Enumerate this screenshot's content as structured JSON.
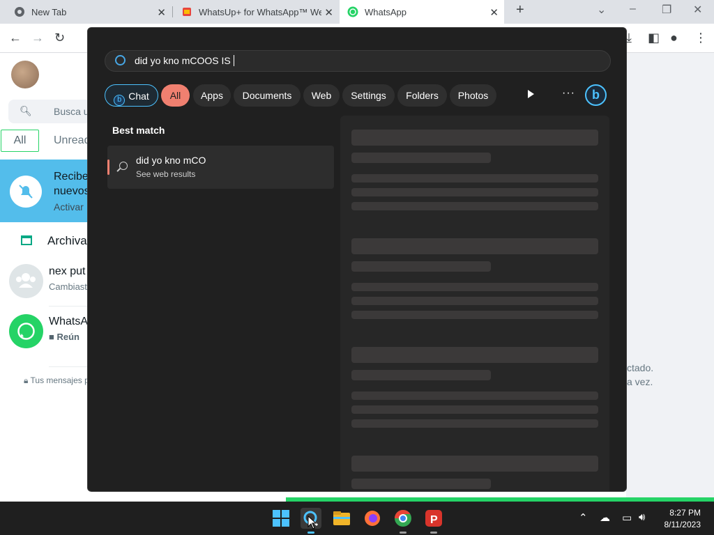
{
  "browser": {
    "tabs": [
      {
        "title": "New Tab",
        "icon": "chrome-icon"
      },
      {
        "title": "WhatsUp+ for WhatsApp™ Web",
        "icon": "extension-icon"
      },
      {
        "title": "WhatsApp",
        "icon": "whatsapp-icon",
        "active": true
      }
    ],
    "new_tab_label": "+",
    "close_label": "✕"
  },
  "whatsapp": {
    "search_placeholder": "Busca u",
    "filters": {
      "all": "All",
      "unread": "Unread"
    },
    "notification": {
      "line1": "Recibe",
      "line2": "nuevos",
      "action": "Activar"
    },
    "archived_label": "Archiva",
    "chats": [
      {
        "name": "nex put",
        "preview": "Cambiast"
      },
      {
        "name": "WhatsA",
        "preview": "Reún"
      }
    ],
    "encryption_note": "Tus mensajes p",
    "right_text_1": "ctado.",
    "right_text_2": "a vez."
  },
  "search_panel": {
    "query": "did yo kno mCOOS IS",
    "chips": {
      "chat": "Chat",
      "all": "All",
      "apps": "Apps",
      "documents": "Documents",
      "web": "Web",
      "settings": "Settings",
      "folders": "Folders",
      "photos": "Photos"
    },
    "more_label": "···",
    "best_match_heading": "Best match",
    "best_match": {
      "title": "did yo kno mCO",
      "subtitle": "See web results"
    }
  },
  "taskbar": {
    "time": "8:27 PM",
    "date": "8/11/2023",
    "apps": [
      "start-icon",
      "search-icon",
      "file-explorer-icon",
      "firefox-icon",
      "chrome-icon",
      "psiphon-icon"
    ]
  },
  "colors": {
    "accent_chip": "#f08070",
    "bing_blue": "#4cc2ff",
    "whatsapp_green": "#25d366",
    "banner_blue": "#53bdeb"
  }
}
